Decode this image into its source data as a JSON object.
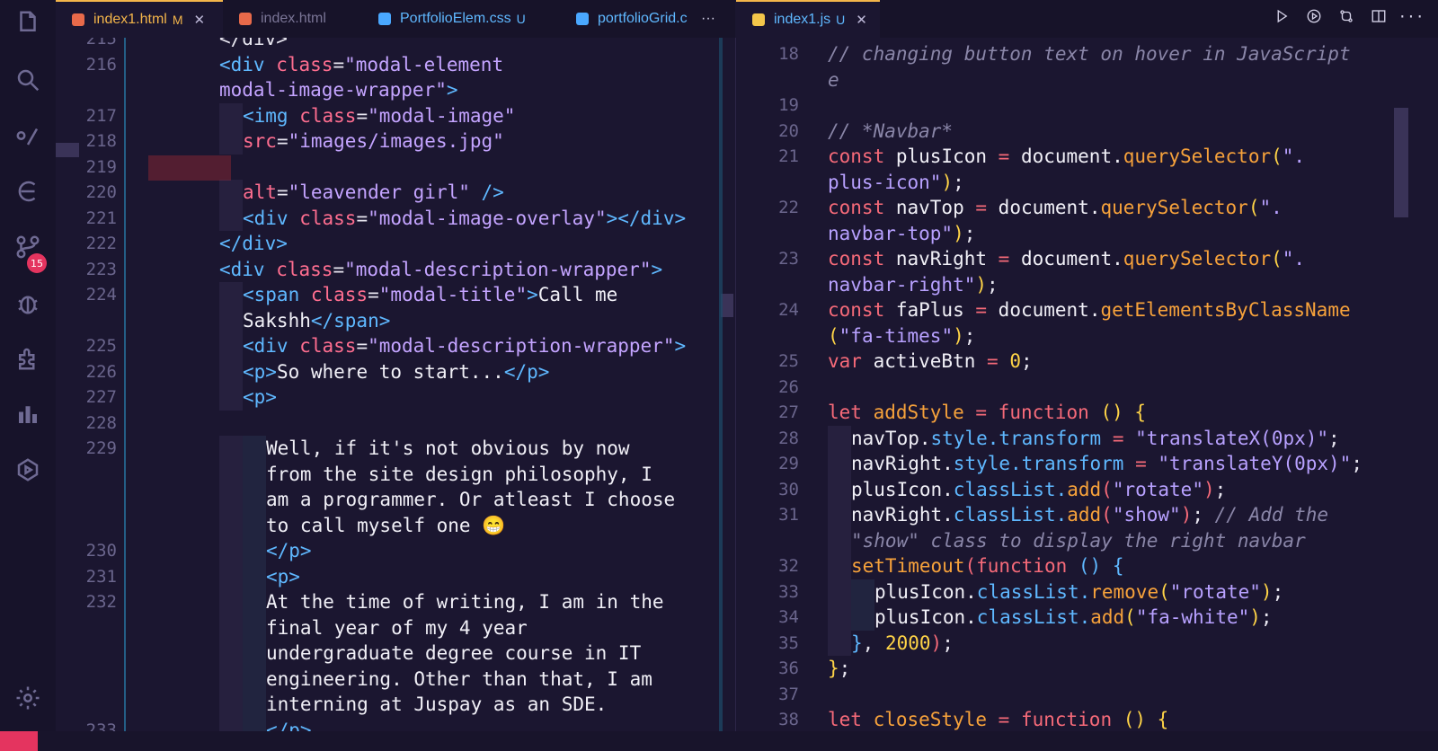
{
  "tabs_left": [
    {
      "label": "index1.html",
      "mark": "M",
      "active": true,
      "icon_color": "#e86a4a"
    },
    {
      "label": "index.html",
      "mark": "",
      "active": false,
      "icon_color": "#e86a4a"
    },
    {
      "label": "PortfolioElem.css",
      "mark": "U",
      "active": false,
      "icon_color": "#4aa8ff"
    },
    {
      "label": "portfolioGrid.c",
      "mark": "",
      "active": false,
      "icon_color": "#4aa8ff"
    }
  ],
  "tab_more": "···",
  "tabs_right": [
    {
      "label": "index1.js",
      "mark": "U",
      "active": true,
      "icon_color": "#f3c64a"
    }
  ],
  "badge_count": "15",
  "left_editor": {
    "lines": [
      {
        "n": "215",
        "parts": [
          [
            "punc",
            "</div>"
          ]
        ]
      },
      {
        "n": "216",
        "parts": [
          [
            "tag",
            "<div "
          ],
          [
            "attr",
            "class"
          ],
          [
            "punc",
            "="
          ],
          [
            "str",
            "\"modal-element"
          ]
        ]
      },
      {
        "n": "",
        "parts": [
          [
            "str",
            "modal-image-wrapper\""
          ],
          [
            "tag",
            ">"
          ]
        ]
      },
      {
        "n": "217",
        "parts": [
          [
            "tag",
            "<img "
          ],
          [
            "attr",
            "class"
          ],
          [
            "punc",
            "="
          ],
          [
            "str",
            "\"modal-image\""
          ]
        ],
        "indent": 1
      },
      {
        "n": "218",
        "parts": [
          [
            "attr",
            "src"
          ],
          [
            "punc",
            "="
          ],
          [
            "str",
            "\"images/images.jpg\""
          ]
        ],
        "indent": 1
      },
      {
        "n": "219",
        "parts": []
      },
      {
        "n": "220",
        "parts": [
          [
            "attr",
            "alt"
          ],
          [
            "punc",
            "="
          ],
          [
            "str",
            "\"leavender girl\""
          ],
          [
            "tag",
            " />"
          ]
        ],
        "indent": 1
      },
      {
        "n": "221",
        "parts": [
          [
            "tag",
            "<div "
          ],
          [
            "attr",
            "class"
          ],
          [
            "punc",
            "="
          ],
          [
            "str",
            "\"modal-image-overlay\""
          ],
          [
            "tag",
            "></div>"
          ]
        ],
        "indent": 1
      },
      {
        "n": "222",
        "parts": [
          [
            "tag",
            "</div>"
          ]
        ]
      },
      {
        "n": "223",
        "parts": [
          [
            "tag",
            "<div "
          ],
          [
            "attr",
            "class"
          ],
          [
            "punc",
            "="
          ],
          [
            "str",
            "\"modal-description-wrapper\""
          ],
          [
            "tag",
            ">"
          ]
        ]
      },
      {
        "n": "224",
        "parts": [
          [
            "tag",
            "<span "
          ],
          [
            "attr",
            "class"
          ],
          [
            "punc",
            "="
          ],
          [
            "str",
            "\"modal-title\""
          ],
          [
            "tag",
            ">"
          ],
          [
            "txt",
            "Call me"
          ]
        ],
        "indent": 1
      },
      {
        "n": "",
        "parts": [
          [
            "txt",
            "Sakshh"
          ],
          [
            "tag",
            "</span>"
          ]
        ],
        "indent": 1
      },
      {
        "n": "225",
        "parts": [
          [
            "tag",
            "<div "
          ],
          [
            "attr",
            "class"
          ],
          [
            "punc",
            "="
          ],
          [
            "str",
            "\"modal-description-wrapper\""
          ],
          [
            "tag",
            ">"
          ]
        ],
        "indent": 1
      },
      {
        "n": "226",
        "parts": [
          [
            "tag",
            "<p>"
          ],
          [
            "txt",
            "So where to start..."
          ],
          [
            "tag",
            "</p>"
          ]
        ],
        "indent": 1
      },
      {
        "n": "227",
        "parts": [
          [
            "tag",
            "<p>"
          ]
        ],
        "indent": 1
      },
      {
        "n": "228",
        "parts": []
      },
      {
        "n": "229",
        "parts": [
          [
            "txt",
            "Well, if it's not obvious by now"
          ]
        ],
        "indent": 2
      },
      {
        "n": "",
        "parts": [
          [
            "txt",
            "from the site design philosophy, I"
          ]
        ],
        "indent": 2
      },
      {
        "n": "",
        "parts": [
          [
            "txt",
            "am a programmer. Or atleast I choose"
          ]
        ],
        "indent": 2
      },
      {
        "n": "",
        "parts": [
          [
            "txt",
            "to call myself one 😁"
          ]
        ],
        "indent": 2
      },
      {
        "n": "230",
        "parts": [
          [
            "tag",
            "</p>"
          ]
        ],
        "indent": 2
      },
      {
        "n": "231",
        "parts": [
          [
            "tag",
            "<p>"
          ]
        ],
        "indent": 2
      },
      {
        "n": "232",
        "parts": [
          [
            "txt",
            "At the time of writing, I am in the"
          ]
        ],
        "indent": 2
      },
      {
        "n": "",
        "parts": [
          [
            "txt",
            "final year of my 4 year"
          ]
        ],
        "indent": 2
      },
      {
        "n": "",
        "parts": [
          [
            "txt",
            "undergraduate degree course in IT"
          ]
        ],
        "indent": 2
      },
      {
        "n": "",
        "parts": [
          [
            "txt",
            "engineering. Other than that, I am"
          ]
        ],
        "indent": 2
      },
      {
        "n": "",
        "parts": [
          [
            "txt",
            "interning at Juspay as an SDE."
          ]
        ],
        "indent": 2
      },
      {
        "n": "233",
        "parts": [
          [
            "tag",
            "</p>"
          ]
        ],
        "indent": 2
      }
    ]
  },
  "right_editor": {
    "lines": [
      {
        "n": "18",
        "parts": [
          [
            "cm",
            "// changing button text on hover in JavaScript"
          ]
        ]
      },
      {
        "n": "",
        "parts": [
          [
            "cm",
            "e"
          ]
        ]
      },
      {
        "n": "19",
        "parts": []
      },
      {
        "n": "20",
        "parts": [
          [
            "cm",
            "// *Navbar*"
          ]
        ]
      },
      {
        "n": "21",
        "parts": [
          [
            "kw",
            "const "
          ],
          [
            "txt",
            "plusIcon "
          ],
          [
            "op",
            "= "
          ],
          [
            "txt",
            "document."
          ],
          [
            "fn",
            "querySelector"
          ],
          [
            "brk",
            "("
          ],
          [
            "strj",
            "\"."
          ]
        ]
      },
      {
        "n": "",
        "parts": [
          [
            "strj",
            "plus-icon\""
          ],
          [
            "brk",
            ")"
          ],
          [
            "punc",
            ";"
          ]
        ]
      },
      {
        "n": "22",
        "parts": [
          [
            "kw",
            "const "
          ],
          [
            "txt",
            "navTop "
          ],
          [
            "op",
            "= "
          ],
          [
            "txt",
            "document."
          ],
          [
            "fn",
            "querySelector"
          ],
          [
            "brk",
            "("
          ],
          [
            "strj",
            "\"."
          ]
        ]
      },
      {
        "n": "",
        "parts": [
          [
            "strj",
            "navbar-top\""
          ],
          [
            "brk",
            ")"
          ],
          [
            "punc",
            ";"
          ]
        ]
      },
      {
        "n": "23",
        "parts": [
          [
            "kw",
            "const "
          ],
          [
            "txt",
            "navRight "
          ],
          [
            "op",
            "= "
          ],
          [
            "txt",
            "document."
          ],
          [
            "fn",
            "querySelector"
          ],
          [
            "brk",
            "("
          ],
          [
            "strj",
            "\"."
          ]
        ]
      },
      {
        "n": "",
        "parts": [
          [
            "strj",
            "navbar-right\""
          ],
          [
            "brk",
            ")"
          ],
          [
            "punc",
            ";"
          ]
        ]
      },
      {
        "n": "24",
        "parts": [
          [
            "kw",
            "const "
          ],
          [
            "txt",
            "faPlus "
          ],
          [
            "op",
            "= "
          ],
          [
            "txt",
            "document."
          ],
          [
            "fn",
            "getElementsByClassName"
          ]
        ]
      },
      {
        "n": "",
        "parts": [
          [
            "brk",
            "("
          ],
          [
            "strj",
            "\"fa-times\""
          ],
          [
            "brk",
            ")"
          ],
          [
            "punc",
            ";"
          ]
        ]
      },
      {
        "n": "25",
        "parts": [
          [
            "kw",
            "var "
          ],
          [
            "txt",
            "activeBtn "
          ],
          [
            "op",
            "= "
          ],
          [
            "num",
            "0"
          ],
          [
            "punc",
            ";"
          ]
        ]
      },
      {
        "n": "26",
        "parts": []
      },
      {
        "n": "27",
        "parts": [
          [
            "kw",
            "let "
          ],
          [
            "fn",
            "addStyle "
          ],
          [
            "op",
            "= "
          ],
          [
            "kw",
            "function "
          ],
          [
            "brk",
            "() {"
          ]
        ]
      },
      {
        "n": "28",
        "parts": [
          [
            "txt",
            "navTop."
          ],
          [
            "prop",
            "style.transform "
          ],
          [
            "op",
            "= "
          ],
          [
            "strj",
            "\"translateX(0px)\""
          ],
          [
            "punc",
            ";"
          ]
        ],
        "indent": 1
      },
      {
        "n": "29",
        "parts": [
          [
            "txt",
            "navRight."
          ],
          [
            "prop",
            "style.transform "
          ],
          [
            "op",
            "= "
          ],
          [
            "strj",
            "\"translateY(0px)\""
          ],
          [
            "punc",
            ";"
          ]
        ],
        "indent": 1
      },
      {
        "n": "30",
        "parts": [
          [
            "txt",
            "plusIcon."
          ],
          [
            "prop",
            "classList."
          ],
          [
            "fn",
            "add"
          ],
          [
            "brk2",
            "("
          ],
          [
            "strj",
            "\"rotate\""
          ],
          [
            "brk2",
            ")"
          ],
          [
            "punc",
            ";"
          ]
        ],
        "indent": 1
      },
      {
        "n": "31",
        "parts": [
          [
            "txt",
            "navRight."
          ],
          [
            "prop",
            "classList."
          ],
          [
            "fn",
            "add"
          ],
          [
            "brk2",
            "("
          ],
          [
            "strj",
            "\"show\""
          ],
          [
            "brk2",
            ")"
          ],
          [
            "punc",
            "; "
          ],
          [
            "cm",
            "// Add the"
          ]
        ],
        "indent": 1
      },
      {
        "n": "",
        "parts": [
          [
            "cm",
            "\"show\" class to display the right navbar"
          ]
        ],
        "indent": 1
      },
      {
        "n": "32",
        "parts": [
          [
            "fn",
            "setTimeout"
          ],
          [
            "brk2",
            "("
          ],
          [
            "kw",
            "function "
          ],
          [
            "brk3",
            "() {"
          ]
        ],
        "indent": 1
      },
      {
        "n": "33",
        "parts": [
          [
            "txt",
            "plusIcon."
          ],
          [
            "prop",
            "classList."
          ],
          [
            "fn",
            "remove"
          ],
          [
            "brk",
            "("
          ],
          [
            "strj",
            "\"rotate\""
          ],
          [
            "brk",
            ")"
          ],
          [
            "punc",
            ";"
          ]
        ],
        "indent": 2
      },
      {
        "n": "34",
        "parts": [
          [
            "txt",
            "plusIcon."
          ],
          [
            "prop",
            "classList."
          ],
          [
            "fn",
            "add"
          ],
          [
            "brk",
            "("
          ],
          [
            "strj",
            "\"fa-white\""
          ],
          [
            "brk",
            ")"
          ],
          [
            "punc",
            ";"
          ]
        ],
        "indent": 2
      },
      {
        "n": "35",
        "parts": [
          [
            "brk3",
            "}"
          ],
          [
            "punc",
            ", "
          ],
          [
            "num",
            "2000"
          ],
          [
            "brk2",
            ")"
          ],
          [
            "punc",
            ";"
          ]
        ],
        "indent": 1
      },
      {
        "n": "36",
        "parts": [
          [
            "brk",
            "}"
          ],
          [
            "punc",
            ";"
          ]
        ]
      },
      {
        "n": "37",
        "parts": []
      },
      {
        "n": "38",
        "parts": [
          [
            "kw",
            "let "
          ],
          [
            "fn",
            "closeStyle "
          ],
          [
            "op",
            "= "
          ],
          [
            "kw",
            "function "
          ],
          [
            "brk",
            "() {"
          ]
        ]
      }
    ]
  },
  "colors": {
    "accent": "#f3b54a",
    "badge": "#e4345f",
    "background": "#1b1630"
  }
}
